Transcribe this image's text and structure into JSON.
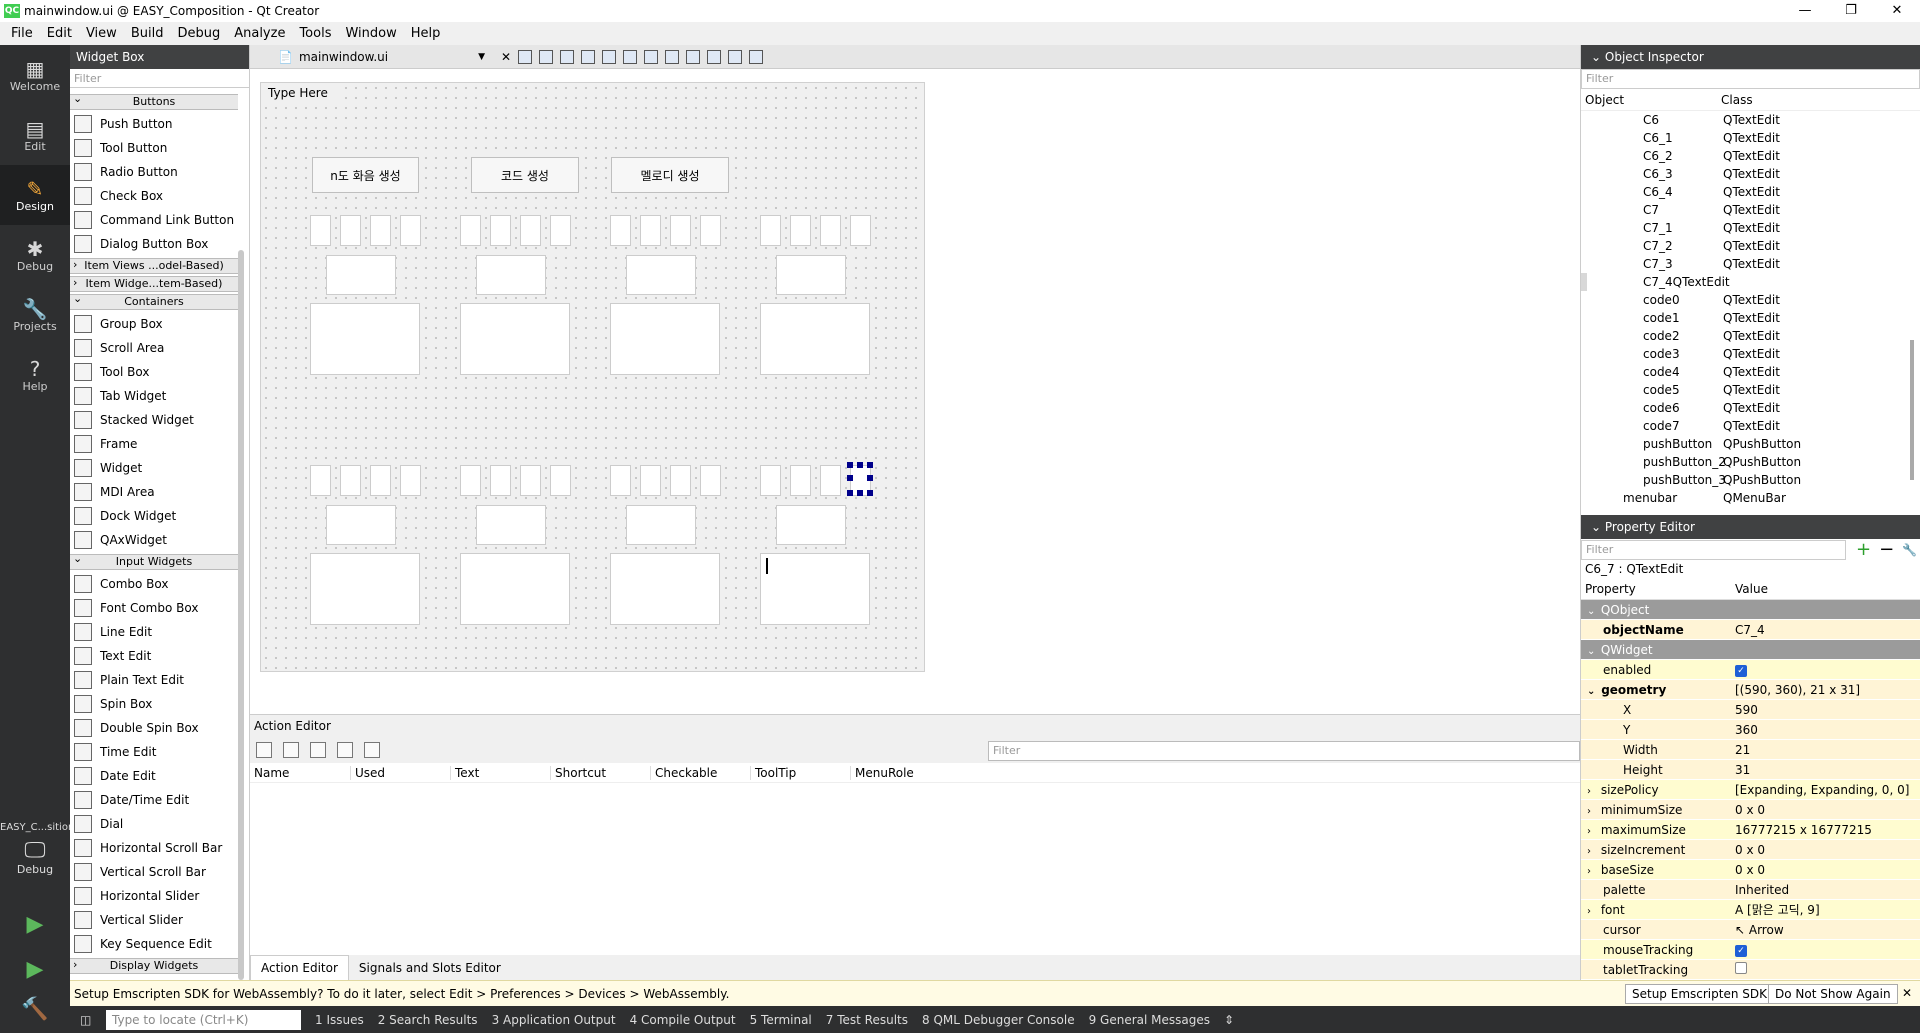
{
  "window": {
    "logo": "QC",
    "title": "mainwindow.ui @ EASY_Composition - Qt Creator",
    "minimize": "—",
    "maximize": "❐",
    "close": "✕"
  },
  "menu": [
    "File",
    "Edit",
    "View",
    "Build",
    "Debug",
    "Analyze",
    "Tools",
    "Window",
    "Help"
  ],
  "modes": [
    {
      "label": "Welcome",
      "icon": "▦"
    },
    {
      "label": "Edit",
      "icon": "▤"
    },
    {
      "label": "Design",
      "icon": "✎"
    },
    {
      "label": "Debug",
      "icon": "✱"
    },
    {
      "label": "Projects",
      "icon": "🔧"
    },
    {
      "label": "Help",
      "icon": "?"
    }
  ],
  "kit": {
    "name": "EASY_C...sition",
    "label": "Debug"
  },
  "widget_box": {
    "title": "Widget Box",
    "filter_placeholder": "Filter",
    "cat_buttons": "Buttons",
    "buttons": [
      "Push Button",
      "Tool Button",
      "Radio Button",
      "Check Box",
      "Command Link Button",
      "Dialog Button Box"
    ],
    "cat_item_views": "Item Views ...odel-Based)",
    "cat_item_widgets": "Item Widge...tem-Based)",
    "cat_containers": "Containers",
    "containers": [
      "Group Box",
      "Scroll Area",
      "Tool Box",
      "Tab Widget",
      "Stacked Widget",
      "Frame",
      "Widget",
      "MDI Area",
      "Dock Widget",
      "QAxWidget"
    ],
    "cat_input": "Input Widgets",
    "inputs": [
      "Combo Box",
      "Font Combo Box",
      "Line Edit",
      "Text Edit",
      "Plain Text Edit",
      "Spin Box",
      "Double Spin Box",
      "Time Edit",
      "Date Edit",
      "Date/Time Edit",
      "Dial",
      "Horizontal Scroll Bar",
      "Vertical Scroll Bar",
      "Horizontal Slider",
      "Vertical Slider",
      "Key Sequence Edit"
    ],
    "cat_display": "Display Widgets"
  },
  "editor": {
    "file": "mainwindow.ui",
    "typehere": "Type Here",
    "btn_chord": "n도 화음 생성",
    "btn_code": "코드 생성",
    "btn_melody": "멜로디 생성"
  },
  "action_editor": {
    "title": "Action Editor",
    "filter_placeholder": "Filter",
    "columns": [
      "Name",
      "Used",
      "Text",
      "Shortcut",
      "Checkable",
      "ToolTip",
      "MenuRole"
    ]
  },
  "bottom_tabs": [
    "Action Editor",
    "Signals and Slots Editor"
  ],
  "infobar": {
    "message": "Setup Emscripten SDK for WebAssembly? To do it later, select Edit > Preferences > Devices > WebAssembly.",
    "setup": "Setup Emscripten SDK",
    "dont_show": "Do Not Show Again",
    "close": "✕"
  },
  "statusbar": {
    "locate_placeholder": "Type to locate (Ctrl+K)",
    "tabs": [
      "1  Issues",
      "2  Search Results",
      "3  Application Output",
      "4  Compile Output",
      "5  Terminal",
      "7  Test Results",
      "8  QML Debugger Console",
      "9  General Messages"
    ]
  },
  "object_inspector": {
    "title": "Object Inspector",
    "filter_placeholder": "Filter",
    "col_object": "Object",
    "col_class": "Class",
    "rows": [
      [
        "C6",
        "QTextEdit"
      ],
      [
        "C6_1",
        "QTextEdit"
      ],
      [
        "C6_2",
        "QTextEdit"
      ],
      [
        "C6_3",
        "QTextEdit"
      ],
      [
        "C6_4",
        "QTextEdit"
      ],
      [
        "C7",
        "QTextEdit"
      ],
      [
        "C7_1",
        "QTextEdit"
      ],
      [
        "C7_2",
        "QTextEdit"
      ],
      [
        "C7_3",
        "QTextEdit"
      ],
      [
        "C7_4",
        "QTextEdit"
      ],
      [
        "code0",
        "QTextEdit"
      ],
      [
        "code1",
        "QTextEdit"
      ],
      [
        "code2",
        "QTextEdit"
      ],
      [
        "code3",
        "QTextEdit"
      ],
      [
        "code4",
        "QTextEdit"
      ],
      [
        "code5",
        "QTextEdit"
      ],
      [
        "code6",
        "QTextEdit"
      ],
      [
        "code7",
        "QTextEdit"
      ],
      [
        "pushButton",
        "QPushButton"
      ],
      [
        "pushButton_2",
        "QPushButton"
      ],
      [
        "pushButton_3",
        "QPushButton"
      ],
      [
        "menubar",
        "QMenuBar"
      ]
    ],
    "selected_row": 9
  },
  "property_editor": {
    "title": "Property Editor",
    "filter_placeholder": "Filter",
    "caption": "C6_7 : QTextEdit",
    "col_property": "Property",
    "col_value": "Value",
    "rows": [
      {
        "k": "QObject",
        "v": "",
        "t": "grp"
      },
      {
        "k": "objectName",
        "v": "C7_4",
        "t": "yl",
        "b": true
      },
      {
        "k": "QWidget",
        "v": "",
        "t": "grp"
      },
      {
        "k": "enabled",
        "v": "",
        "t": "yl2",
        "chk": true
      },
      {
        "k": "geometry",
        "v": "[(590, 360), 21 x 31]",
        "t": "yl",
        "b": true,
        "exp": "open"
      },
      {
        "k": "X",
        "v": "590",
        "t": "yl",
        "sub": true
      },
      {
        "k": "Y",
        "v": "360",
        "t": "yl",
        "sub": true
      },
      {
        "k": "Width",
        "v": "21",
        "t": "yl",
        "sub": true
      },
      {
        "k": "Height",
        "v": "31",
        "t": "yl",
        "sub": true
      },
      {
        "k": "sizePolicy",
        "v": "[Expanding, Expanding, 0, 0]",
        "t": "yl2",
        "exp": "closed"
      },
      {
        "k": "minimumSize",
        "v": "0 x 0",
        "t": "yl",
        "exp": "closed"
      },
      {
        "k": "maximumSize",
        "v": "16777215 x 16777215",
        "t": "yl2",
        "exp": "closed"
      },
      {
        "k": "sizeIncrement",
        "v": "0 x 0",
        "t": "yl",
        "exp": "closed"
      },
      {
        "k": "baseSize",
        "v": "0 x 0",
        "t": "yl2",
        "exp": "closed"
      },
      {
        "k": "palette",
        "v": "Inherited",
        "t": "yl"
      },
      {
        "k": "font",
        "v": "A  [맑은 고딕, 9]",
        "t": "yl2",
        "exp": "closed"
      },
      {
        "k": "cursor",
        "v": "↖  Arrow",
        "t": "yl"
      },
      {
        "k": "mouseTracking",
        "v": "",
        "t": "yl2",
        "chk": true
      },
      {
        "k": "tabletTracking",
        "v": "",
        "t": "yl",
        "chkoff": true
      }
    ]
  }
}
